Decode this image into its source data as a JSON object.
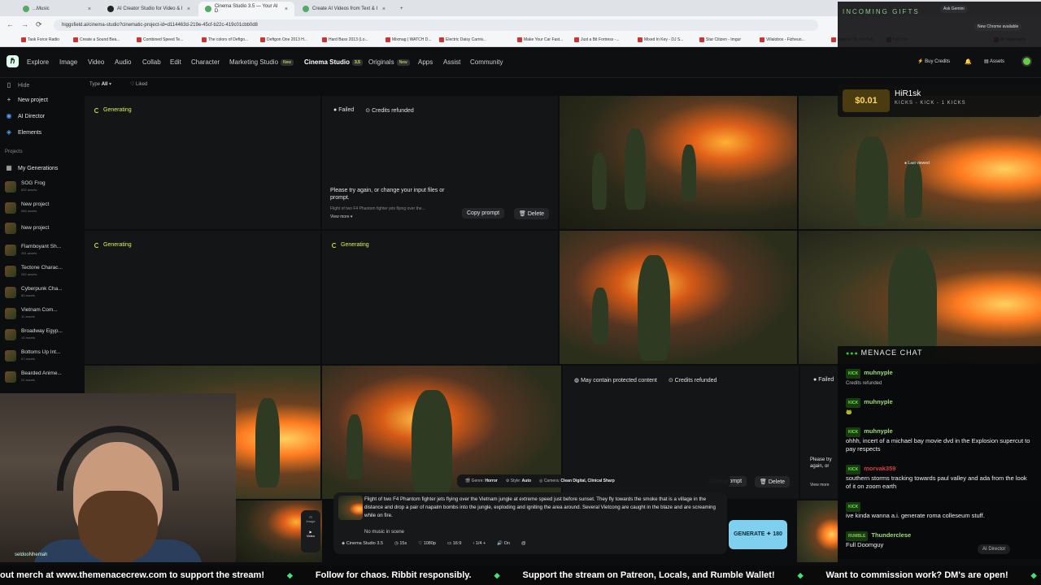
{
  "browser": {
    "tabs": [
      {
        "label": "...Music",
        "active": false
      },
      {
        "label": "AI Creator Studio for Video & I",
        "active": false
      },
      {
        "label": "Cinema Studio 3.5 — Your AI D",
        "active": true
      },
      {
        "label": "Create AI Videos from Text & I",
        "active": false
      }
    ],
    "url": "higgsfield.ai/cinema-studio?cinematic-project-id=d114463d-219e-45cf-b22c-419c01cbb0d8",
    "bookmarks": [
      "Task Force Radio",
      "Create a Sound Bea...",
      "Combined Speed Te...",
      "The colors of Deftgo...",
      "Deftgon One 2013 H...",
      "Hard Bass 2013 (Lo...",
      "Mixmag | WATCH D...",
      "Electric Daisy Carniv...",
      "Make Your Car Fast...",
      "Just a Bit Fortress -...",
      "Mixed In Key - DJ S...",
      "Star Citizen - Imgur",
      "Villalobos - Fizheuo...",
      "Bonobo 50 min Boil...",
      "Kritz.net",
      "All Bookmarks"
    ],
    "new_chrome": "New Chrome available",
    "ask_gemini": "Ask Gemini"
  },
  "nav": {
    "items": [
      "Explore",
      "Image",
      "Video",
      "Audio",
      "Collab",
      "Edit",
      "Character",
      "Marketing Studio",
      "Cinema Studio",
      "Originals",
      "Apps",
      "Assist",
      "Community"
    ],
    "new_badge": "New",
    "cinema_badge": "3.5",
    "buy_credits": "Buy Credits",
    "assets": "Assets"
  },
  "sidebar": {
    "hide": "Hide",
    "new_project": "New project",
    "ai_director": "AI Director",
    "elements": "Elements",
    "projects_heading": "Projects",
    "my_generations": "My Generations",
    "projects": [
      {
        "name": "SOG Frog",
        "count": "832 assets"
      },
      {
        "name": "New project",
        "count": "586 assets"
      },
      {
        "name": "New project",
        "count": ""
      },
      {
        "name": "Flamboyant Sh...",
        "count": "281 assets"
      },
      {
        "name": "Tectone Charac...",
        "count": "262 assets"
      },
      {
        "name": "Cyberpunk Cha...",
        "count": "80 assets"
      },
      {
        "name": "Vietnam Com...",
        "count": "11 assets"
      },
      {
        "name": "Broadway Egyp...",
        "count": "10 assets"
      },
      {
        "name": "Bottoms Up Int...",
        "count": "67 assets"
      },
      {
        "name": "Bearded Anime...",
        "count": "22 assets"
      }
    ]
  },
  "filters": {
    "type_label": "Type",
    "type_value": "All",
    "liked": "Liked"
  },
  "cells": {
    "generating": "Generating",
    "failed": "Failed",
    "credits_refunded": "Credits refunded",
    "try_again": "Please try again, or change your input files or prompt.",
    "prompt_snip": "Flight of two F4 Phantom fighter jets flying over the...",
    "view_more": "View more",
    "copy_prompt": "Copy prompt",
    "delete": "Delete",
    "protected": "May contain protected content",
    "last_viewed": "Last viewed",
    "try_again_short": "Please try again, or change your input files or prompt.",
    "view_more2": "View more"
  },
  "prompt": {
    "genre_label": "Genre:",
    "genre": "Horror",
    "style_label": "Style:",
    "style": "Auto",
    "camera_label": "Camera:",
    "camera": "Clean Digital, Clinical Sharp",
    "text": "Flight of two F4 Phantom fighter jets flying over the Vietnam jungle at extreme speed just before sunset. They fly towards the smoke that is a village in the distance and drop a pair of napalm bombs into the jungle, exploding and igniting the area around. Several Vietcong are caught in the blaze and are screaming while on fire.",
    "music": "No music in scene",
    "model": "Cinema Studio 3.5",
    "duration": "15s",
    "quality": "1080p",
    "ratio": "16:9",
    "count": "1/4",
    "audio": "On",
    "image_tab": "Image",
    "video_tab": "Video",
    "generate": "GENERATE ✦ 180",
    "ai_director_btn": "AI Director"
  },
  "overlay": {
    "gifts_title": "INCOMING GIFTS",
    "donation_amount": "$0.01",
    "donation_user": "HiR1sk",
    "donation_note": "KICKS - KICK - 1 KICKS",
    "chat_title": "MENACE CHAT",
    "chat": [
      {
        "platform": "KICK",
        "user": "muhnyple",
        "text": "Credits refunded"
      },
      {
        "platform": "KICK",
        "user": "muhnyple",
        "text": ""
      },
      {
        "platform": "KICK",
        "user": "muhnyple",
        "text": "ohhh, incert of a michael bay movie dvd in the Explosion supercut to pay respects"
      },
      {
        "platform": "KICK",
        "user": "morvak359",
        "text": "southern storms tracking towards paul valley and ada from the look of it on zoom earth"
      },
      {
        "platform": "KICK",
        "user": "",
        "text": "ive kinda wanna a.i. generate roma colleseum stuff."
      },
      {
        "platform": "RUMBLE",
        "user": "Thunderclese",
        "text": "Full Doomguy"
      }
    ]
  },
  "webcam": {
    "username": "seldooNhemah"
  },
  "ticker": [
    "out merch at www.themenacecrew.com to support the stream!",
    "Follow for chaos. Ribbit responsibly.",
    "Support the stream on Patreon, Locals, and Rumble Wallet!",
    "Want to commission work? DM's are open!",
    "Don't fo"
  ]
}
